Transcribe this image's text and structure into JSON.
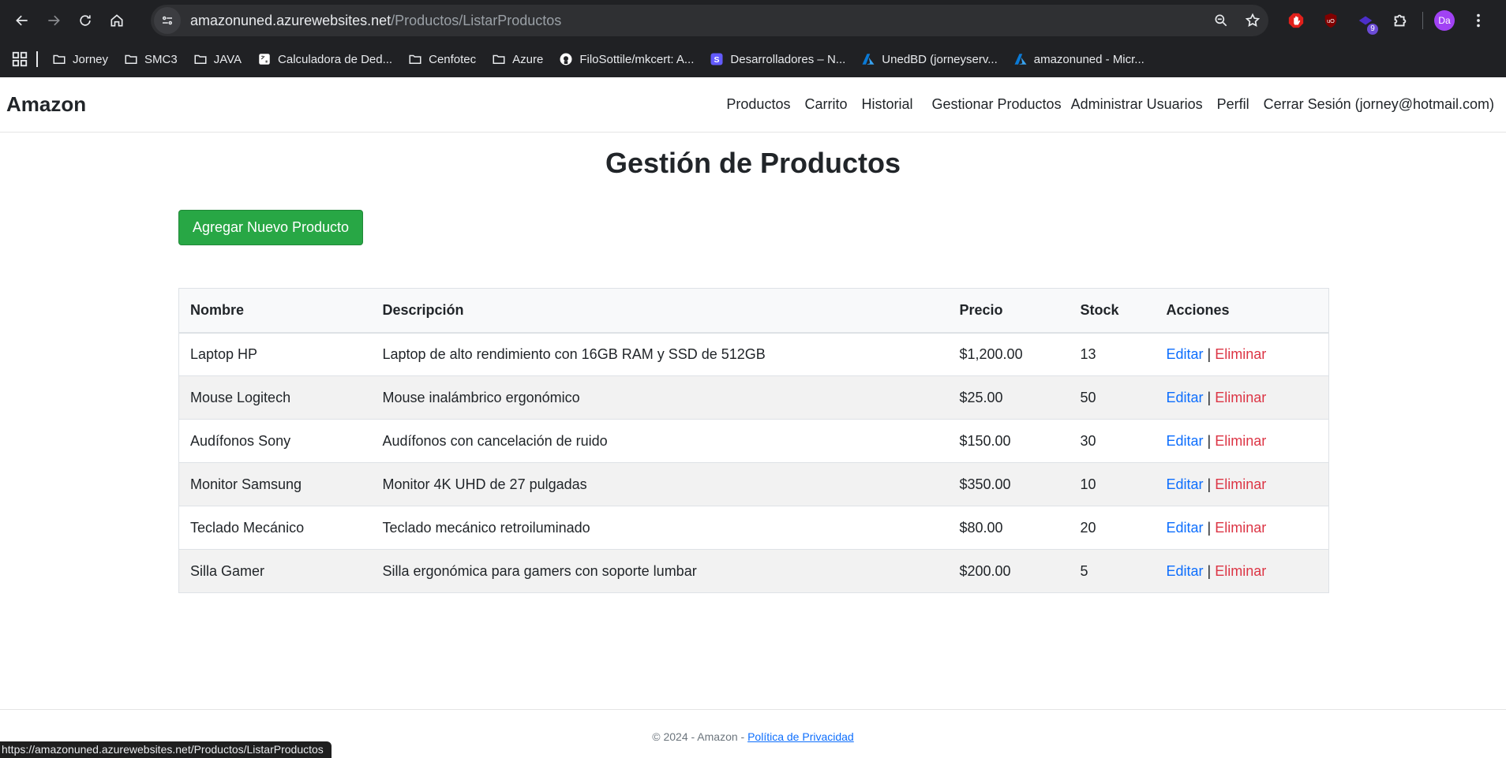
{
  "browser": {
    "url_domain": "amazonuned.azurewebsites.net",
    "url_path": "/Productos/ListarProductos",
    "extension_badge": "9",
    "profile_initials": "Da",
    "bookmarks": [
      {
        "label": "Jorney",
        "icon": "folder-icon"
      },
      {
        "label": "SMC3",
        "icon": "folder-icon"
      },
      {
        "label": "JAVA",
        "icon": "folder-icon"
      },
      {
        "label": "Calculadora de Ded...",
        "icon": "calculator-icon"
      },
      {
        "label": "Cenfotec",
        "icon": "folder-icon"
      },
      {
        "label": "Azure",
        "icon": "folder-icon"
      },
      {
        "label": "FiloSottile/mkcert: A...",
        "icon": "github-icon"
      },
      {
        "label": "Desarrolladores – N...",
        "icon": "stripe-icon"
      },
      {
        "label": "UnedBD (jorneyserv...",
        "icon": "azure-icon"
      },
      {
        "label": "amazonuned - Micr...",
        "icon": "azure-icon"
      }
    ]
  },
  "navbar": {
    "brand": "Amazon",
    "links": [
      "Productos",
      "Carrito",
      "Historial",
      "Gestionar Productos",
      "Administrar Usuarios",
      "Perfil",
      "Cerrar Sesión (jorney@hotmail.com)"
    ]
  },
  "main": {
    "title": "Gestión de Productos",
    "add_button": "Agregar Nuevo Producto",
    "table": {
      "headers": [
        "Nombre",
        "Descripción",
        "Precio",
        "Stock",
        "Acciones"
      ],
      "rows": [
        {
          "nombre": "Laptop HP",
          "descripcion": "Laptop de alto rendimiento con 16GB RAM y SSD de 512GB",
          "precio": "$1,200.00",
          "stock": "13"
        },
        {
          "nombre": "Mouse Logitech",
          "descripcion": "Mouse inalámbrico ergonómico",
          "precio": "$25.00",
          "stock": "50"
        },
        {
          "nombre": "Audífonos Sony",
          "descripcion": "Audífonos con cancelación de ruido",
          "precio": "$150.00",
          "stock": "30"
        },
        {
          "nombre": "Monitor Samsung",
          "descripcion": "Monitor 4K UHD de 27 pulgadas",
          "precio": "$350.00",
          "stock": "10"
        },
        {
          "nombre": "Teclado Mecánico",
          "descripcion": "Teclado mecánico retroiluminado",
          "precio": "$80.00",
          "stock": "20"
        },
        {
          "nombre": "Silla Gamer",
          "descripcion": "Silla ergonómica para gamers con soporte lumbar",
          "precio": "$200.00",
          "stock": "5"
        }
      ],
      "edit_label": "Editar",
      "separator": "|",
      "delete_label": "Eliminar"
    }
  },
  "footer": {
    "text": "© 2024 - Amazon - ",
    "privacy_link": "Política de Privacidad"
  },
  "status_bar": "https://amazonuned.azurewebsites.net/Productos/ListarProductos",
  "colors": {
    "success": "#28a745",
    "link": "#0d6efd",
    "danger": "#dc3545",
    "chrome_bg": "#202124"
  }
}
